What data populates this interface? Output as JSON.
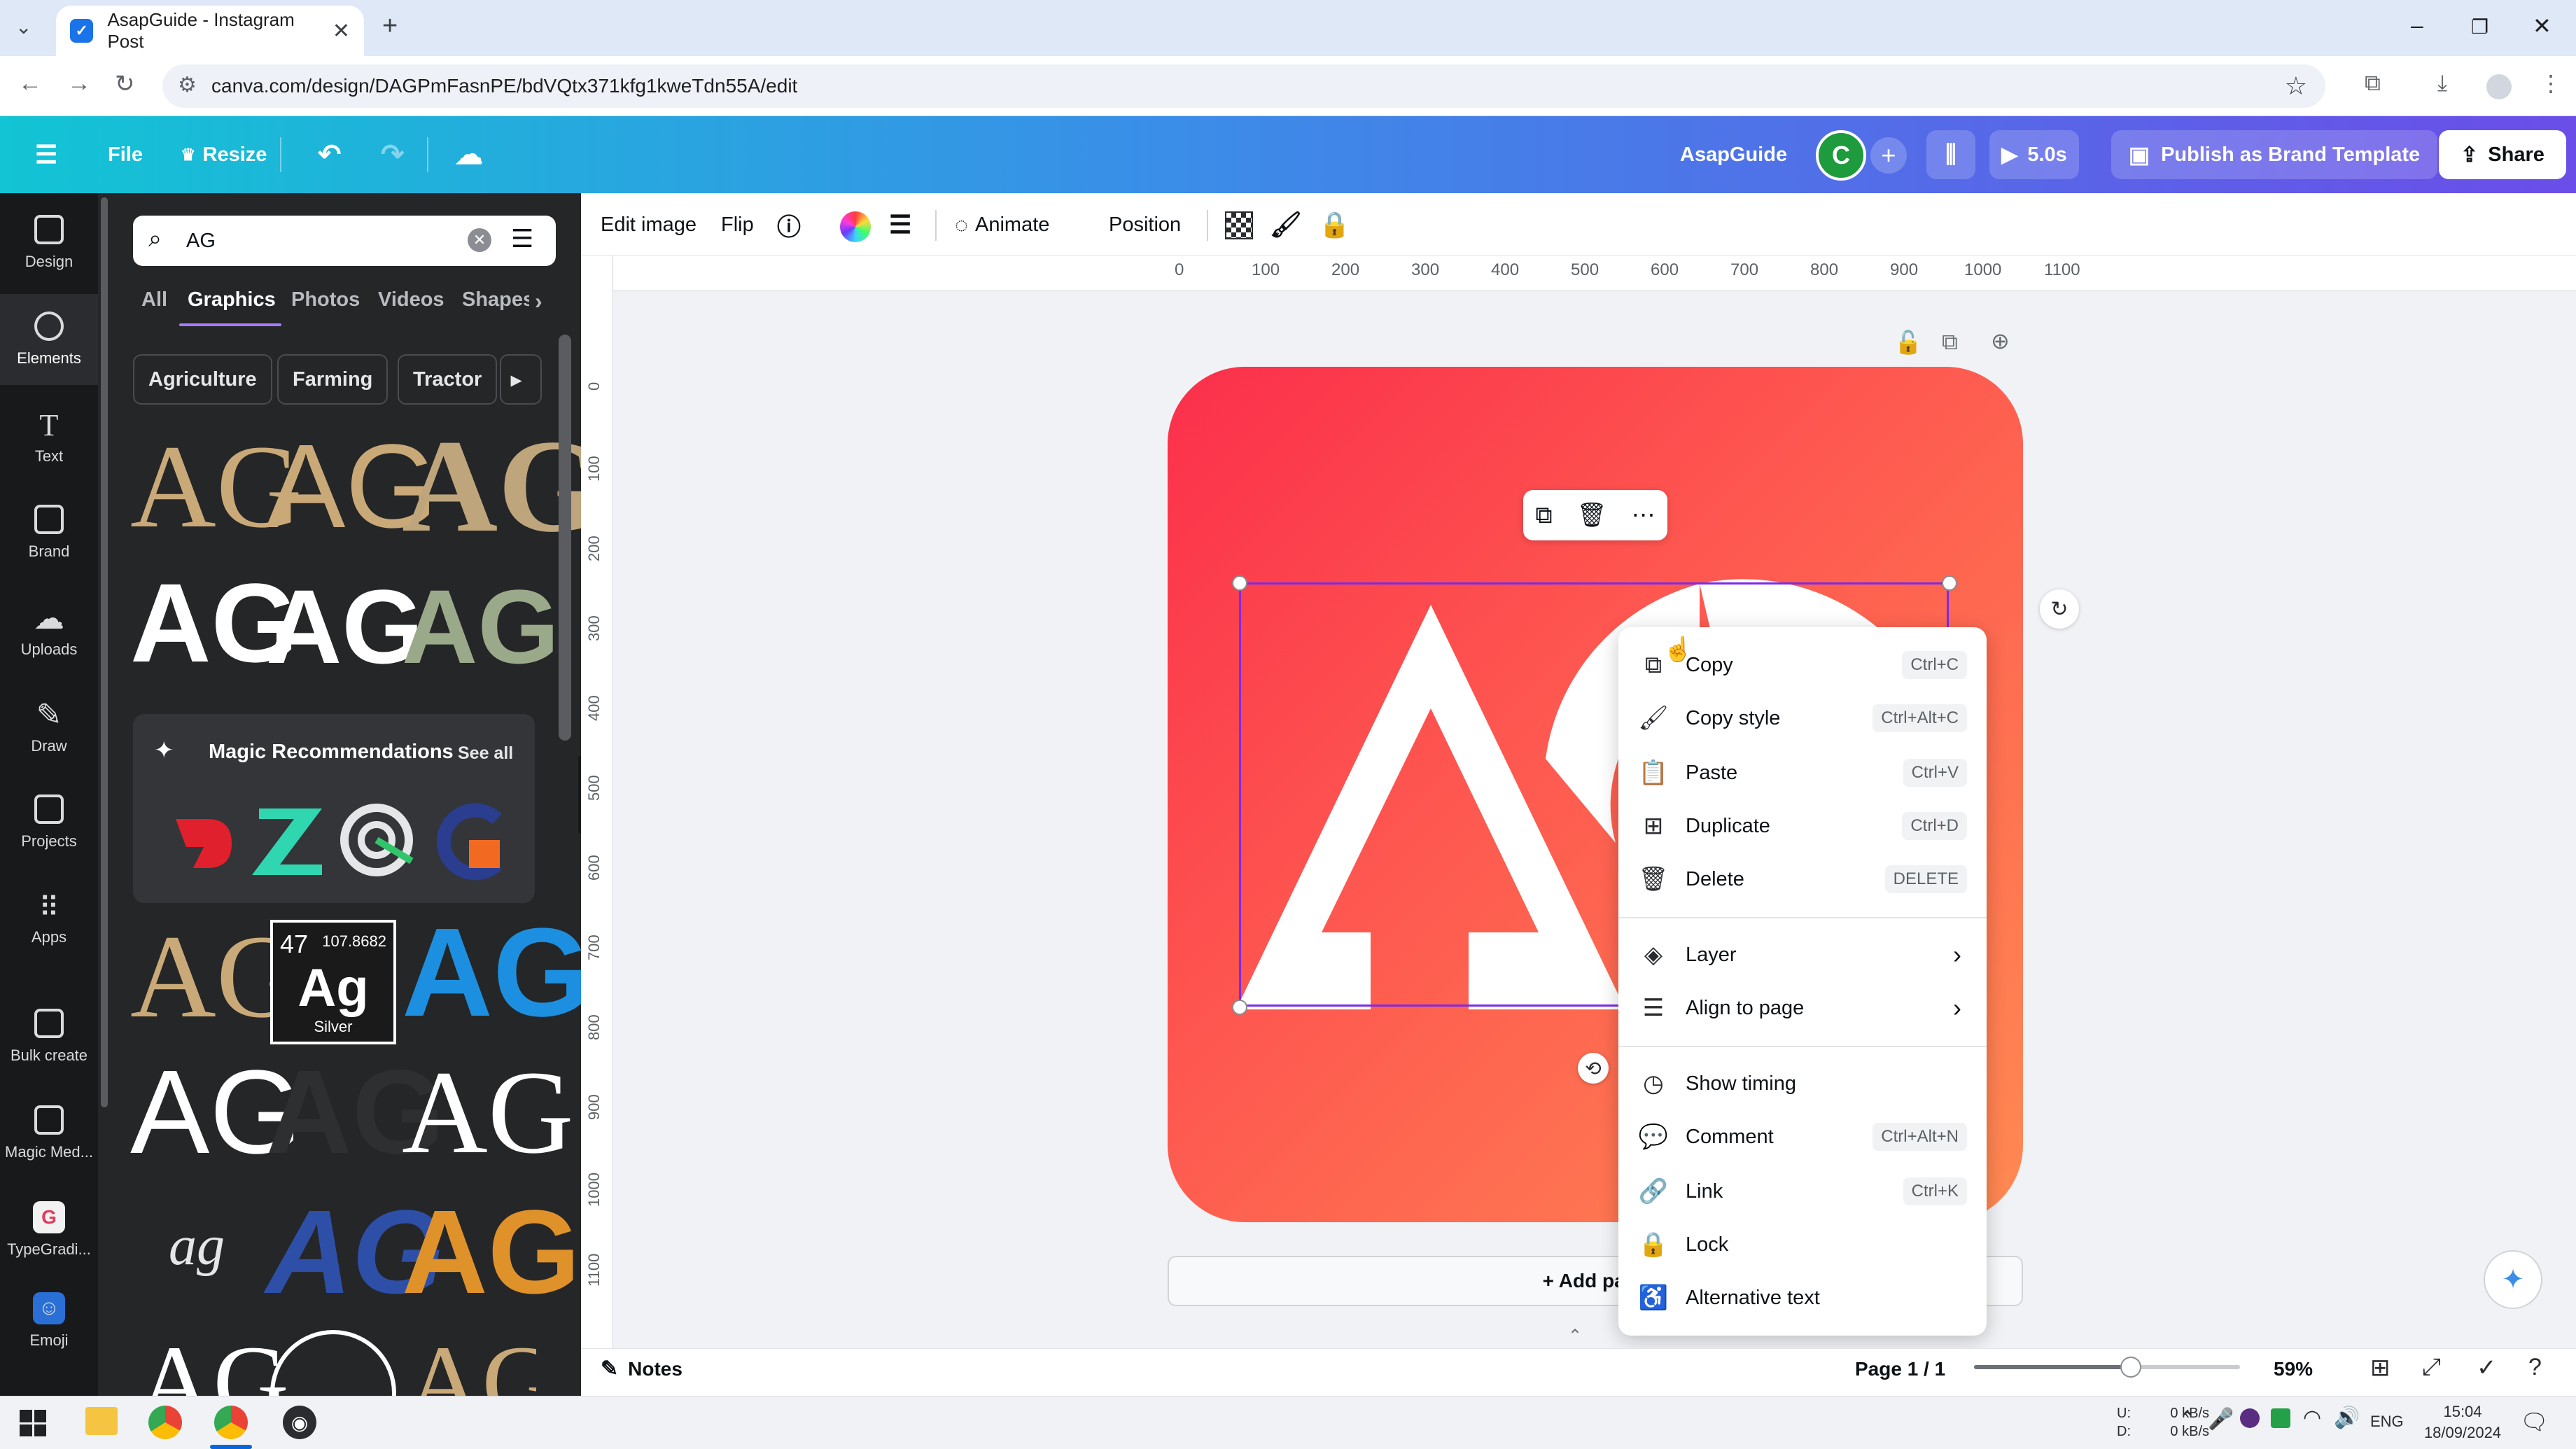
{
  "browser": {
    "tab_title": "AsapGuide - Instagram Post",
    "url": "canva.com/design/DAGPmFasnPE/bdVQtx371kfg1kweTdn55A/edit"
  },
  "header": {
    "file": "File",
    "resize": "Resize",
    "team": "AsapGuide",
    "avatar": "C",
    "play_time": "5.0s",
    "publish": "Publish as Brand Template",
    "share": "Share"
  },
  "rail": [
    {
      "label": "Design"
    },
    {
      "label": "Elements"
    },
    {
      "label": "Text"
    },
    {
      "label": "Brand"
    },
    {
      "label": "Uploads"
    },
    {
      "label": "Draw"
    },
    {
      "label": "Projects"
    },
    {
      "label": "Apps"
    },
    {
      "label": "Bulk create"
    },
    {
      "label": "Magic Med..."
    },
    {
      "label": "TypeGradi..."
    },
    {
      "label": "Emoji"
    }
  ],
  "panel": {
    "search_value": "AG",
    "tabs": [
      "All",
      "Graphics",
      "Photos",
      "Videos",
      "Shapes"
    ],
    "chips": [
      "Agriculture",
      "Farming",
      "Tractor"
    ],
    "magic_title": "Magic Recommendations",
    "see_all": "See all",
    "element_ag": {
      "num": "47",
      "mass": "107.8682",
      "sym": "Ag",
      "name": "Silver"
    },
    "glyph_ag": "AG",
    "glyph_script": "ag"
  },
  "toolbar": {
    "edit_image": "Edit image",
    "flip": "Flip",
    "animate": "Animate",
    "position": "Position"
  },
  "ruler": {
    "top": [
      "0",
      "100",
      "200",
      "300",
      "400",
      "500",
      "600",
      "700",
      "800",
      "900",
      "1000",
      "1100"
    ],
    "left": [
      "0",
      "100",
      "200",
      "300",
      "400",
      "500",
      "600",
      "700",
      "800",
      "900",
      "1000",
      "1100"
    ]
  },
  "context_menu": {
    "items": [
      {
        "label": "Copy",
        "shortcut": "Ctrl+C"
      },
      {
        "label": "Copy style",
        "shortcut": "Ctrl+Alt+C"
      },
      {
        "label": "Paste",
        "shortcut": "Ctrl+V"
      },
      {
        "label": "Duplicate",
        "shortcut": "Ctrl+D"
      },
      {
        "label": "Delete",
        "shortcut": "DELETE"
      },
      {
        "label": "Layer",
        "shortcut": ""
      },
      {
        "label": "Align to page",
        "shortcut": ""
      },
      {
        "label": "Show timing",
        "shortcut": ""
      },
      {
        "label": "Comment",
        "shortcut": "Ctrl+Alt+N"
      },
      {
        "label": "Link",
        "shortcut": "Ctrl+K"
      },
      {
        "label": "Lock",
        "shortcut": ""
      },
      {
        "label": "Alternative text",
        "shortcut": ""
      }
    ]
  },
  "canvas": {
    "add_page": "+ Add page"
  },
  "bottom": {
    "notes": "Notes",
    "page": "Page 1 / 1",
    "zoom": "59%",
    "zoom_fraction": 0.59
  },
  "taskbar": {
    "up_label": "U:",
    "down_label": "D:",
    "up_speed": "0 kB/s",
    "down_speed": "0 kB/s",
    "lang": "ENG",
    "time": "15:04",
    "date": "18/09/2024"
  },
  "colors": {
    "accent": "#7d2ae8",
    "header_start": "#12c4d4",
    "header_end": "#6b4de8",
    "canvas_start": "#fb2f4b",
    "canvas_end": "#ff8a52",
    "gold": "#c9a978"
  }
}
